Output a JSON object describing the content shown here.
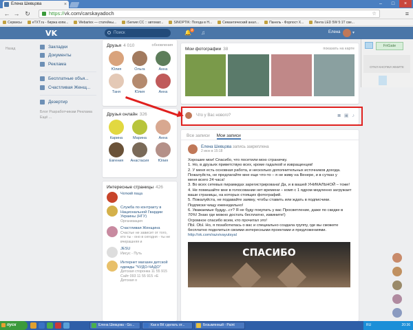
{
  "browser": {
    "tab_title": "Елена Шевцова",
    "url_scheme": "https://",
    "url_rest": "vk.com/carskayadoch",
    "bookmarks": [
      "Сервисы",
      "eTXT.ru - биржа копи...",
      "Webartex — статейны...",
      "iSerwer.CC :: автомат...",
      "SINOPTIK: Погода в Н...",
      "Семантический анал...",
      "Панель - Форпост Х...",
      "Лента LED 5W 5:1T све..."
    ]
  },
  "vk": {
    "logo": "VK",
    "search_placeholder": "Поиск",
    "notify_count": "2",
    "user_name": "Елена"
  },
  "leftnav": {
    "items": [
      "Закладки",
      "Документы",
      "Реклама"
    ],
    "items2": [
      "Бесплатные объя...",
      "Счастливая Женщ..."
    ],
    "items3": [
      "Дезертир"
    ],
    "footer": "Блог  Разработчикам  Реклама  Ещё ...",
    "far_left": "Назад"
  },
  "friends": {
    "title": "Друзья",
    "count": "4 010",
    "updates": "обновления",
    "list": [
      {
        "name": "Юлия",
        "color": "#d9a37c"
      },
      {
        "name": "Ольга",
        "color": "#a27a5e"
      },
      {
        "name": "Анна",
        "color": "#5d7d5a"
      },
      {
        "name": "Таня",
        "color": "#e4c9b6"
      },
      {
        "name": "Юлия",
        "color": "#b48a6e"
      },
      {
        "name": "Анна",
        "color": "#c05a5a"
      }
    ]
  },
  "friends_online": {
    "title": "Друзья онлайн",
    "count": "326",
    "list": [
      {
        "name": "Карина",
        "color": "#e2d840"
      },
      {
        "name": "Марина",
        "color": "#b8c43c"
      },
      {
        "name": "Анна",
        "color": "#d8a890"
      },
      {
        "name": "Евгения",
        "color": "#6a5238"
      },
      {
        "name": "Анастасия",
        "color": "#7a6a58"
      },
      {
        "name": "Юлия",
        "color": "#b49088"
      }
    ]
  },
  "interesting": {
    "title": "Интересные страницы",
    "count": "426",
    "list": [
      {
        "name": "Чоткий паца",
        "desc": "",
        "color": "#c8442a"
      },
      {
        "name": "Служба по контракту в Национальной Гвардии Украины (НГУ)",
        "desc": "Организация",
        "color": "#d4b04a"
      },
      {
        "name": "Счастливая Женщина",
        "desc": "Счастье не зависит от того, кто ты - оно в сегодня - ты не вчерашняя и",
        "color": "#c88aa0"
      },
      {
        "name": "JESU",
        "desc": "Иисус - Путь",
        "color": "#ddd"
      },
      {
        "name": "Интернет магазин детской одежды \"ЧУДО-ЧАДО\"",
        "desc": "Детская сторонка 11 55 915 Сайт 093 11 55 915 +Е Детская о",
        "color": "#e8c06a"
      }
    ]
  },
  "photos_block": {
    "title": "Мои фотографии",
    "count": "38",
    "map_link": "показать на карте",
    "colors": [
      "#7a9a4a",
      "#5a7a6a",
      "#c08888",
      "#8aa0a0"
    ]
  },
  "composer": {
    "placeholder": "Что у Вас нового?"
  },
  "wall_tabs": [
    "Все записи",
    "Мои записи"
  ],
  "post": {
    "author": "Елена Шевцова",
    "pinned": "запись закреплена",
    "date": "2 июн в 15:18",
    "lines": [
      "Хорошие мои! Спасибо, что посетили мою страничку.",
      "1. Но, в друзьях приветствую всех, кроме гадалкой и извращенцев!",
      "2. У меня есть основная работа, и несколько дополнительных источников дохода.",
      "Пожалуйста, не предлагайте мне еще что-то – я не живу на Венере, и в сутках у",
      "меня всего 24 часа!",
      "3. Во всех сетевых пирамидах зарегистрирована! Да, и в вашей УНИКАЛЬНОЙ – тоже!",
      "4. Не помешайте мне в голосовании нет времени – комп с 1 ядром медленно загружает",
      "ваши страницы, на которых стоящих фотографий.",
      "5. Пожалуйста, не подавайте заявку, чтобы ставить или ждать в подписчики.",
      "Подписки чищу еженедельно!",
      "6. Уважаемые будду...ст? Я не буду покупать у вас Просветление, даже по скидке в",
      "70%! Знаю где можно достать бесплатно, извините!)",
      "Огромное спасибо всем, кто прочитал это!",
      "ПЫ. ОЫ. Но, я позаботилась о вас и специально создала группу, где вы сможете",
      "бесплатно поделиться своими интересными проектами и предложениями."
    ],
    "link": "http://vk.com/razvivayutsyal",
    "image_text": "СПАСИБО"
  },
  "extension": {
    "name": "FriGate",
    "hint": "ОТКЛ КНОПКИ ЖМИТЕ"
  },
  "side_avatars": [
    "#c88a6a",
    "#c09060",
    "#9a8a6a",
    "#b08aa0",
    "#8a9ac0",
    "#c0a080",
    "#a07070"
  ],
  "taskbar": {
    "start": "пуск",
    "tasks": [
      "Елена Шевцова - Go...",
      "Как в ВК сделать от...",
      "Безымянный - Paint"
    ],
    "lang": "RU",
    "time": "20:36"
  }
}
